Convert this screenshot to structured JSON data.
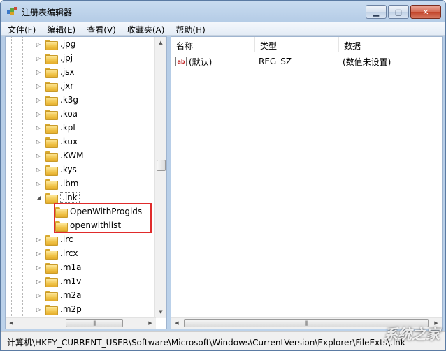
{
  "window": {
    "title": "注册表编辑器"
  },
  "menu": [
    "文件(F)",
    "编辑(E)",
    "查看(V)",
    "收藏夹(A)",
    "帮助(H)"
  ],
  "tree": {
    "items": [
      {
        "label": ".jpg",
        "expander": "▷"
      },
      {
        "label": ".jpj",
        "expander": "▷"
      },
      {
        "label": ".jsx",
        "expander": "▷"
      },
      {
        "label": ".jxr",
        "expander": "▷"
      },
      {
        "label": ".k3g",
        "expander": "▷"
      },
      {
        "label": ".koa",
        "expander": "▷"
      },
      {
        "label": ".kpl",
        "expander": "▷"
      },
      {
        "label": ".kux",
        "expander": "▷"
      },
      {
        "label": ".KWM",
        "expander": "▷"
      },
      {
        "label": ".kys",
        "expander": "▷"
      },
      {
        "label": ".lbm",
        "expander": "▷"
      },
      {
        "label": ".lnk",
        "expander": "◢",
        "selected": true
      },
      {
        "label": "OpenWithProgids",
        "child": true
      },
      {
        "label": "openwithlist",
        "child": true
      },
      {
        "label": ".lrc",
        "expander": "▷"
      },
      {
        "label": ".lrcx",
        "expander": "▷"
      },
      {
        "label": ".m1a",
        "expander": "▷"
      },
      {
        "label": ".m1v",
        "expander": "▷"
      },
      {
        "label": ".m2a",
        "expander": "▷"
      },
      {
        "label": ".m2p",
        "expander": "▷"
      }
    ]
  },
  "list": {
    "columns": {
      "name": "名称",
      "type": "类型",
      "data": "数据"
    },
    "rows": [
      {
        "name": "(默认)",
        "type": "REG_SZ",
        "data": "(数值未设置)"
      }
    ]
  },
  "status": {
    "path": "计算机\\HKEY_CURRENT_USER\\Software\\Microsoft\\Windows\\CurrentVersion\\Explorer\\FileExts\\.lnk"
  },
  "watermark": "系统之家",
  "colors": {
    "highlight_box": "#e02b2b"
  }
}
